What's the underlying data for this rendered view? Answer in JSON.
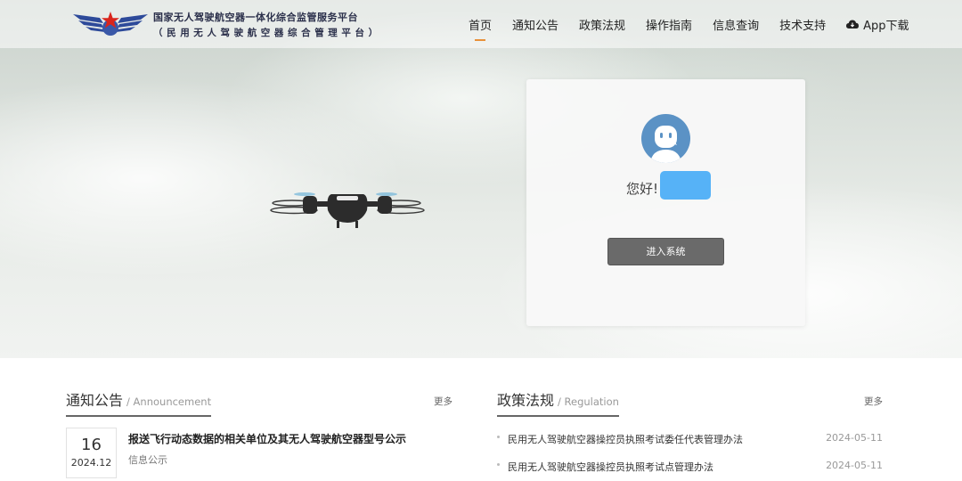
{
  "brand": {
    "line1": "国家无人驾驶航空器一体化综合监管服务平台",
    "line2": "（民用无人驾驶航空器综合管理平台）"
  },
  "nav": {
    "items": [
      {
        "label": "首页"
      },
      {
        "label": "通知公告"
      },
      {
        "label": "政策法规"
      },
      {
        "label": "操作指南"
      },
      {
        "label": "信息查询"
      },
      {
        "label": "技术支持"
      }
    ],
    "download_label": "App下载",
    "active_accent": "#e8913a"
  },
  "login": {
    "greeting": "您好!",
    "enter_label": "进入系统",
    "avatar_color": "#5b92c5",
    "chip_color": "#56b2f7"
  },
  "announcement": {
    "title": "通知公告",
    "subtitle": "/ Announcement",
    "more": "更多",
    "item": {
      "day": "16",
      "year_month": "2024.12",
      "title": "报送飞行动态数据的相关单位及其无人驾驶航空器型号公示",
      "category": "信息公示"
    }
  },
  "policy": {
    "title": "政策法规",
    "subtitle": "/ Regulation",
    "more": "更多",
    "items": [
      {
        "title": "民用无人驾驶航空器操控员执照考试委任代表管理办法",
        "date": "2024-05-11"
      },
      {
        "title": "民用无人驾驶航空器操控员执照考试点管理办法",
        "date": "2024-05-11"
      }
    ]
  }
}
